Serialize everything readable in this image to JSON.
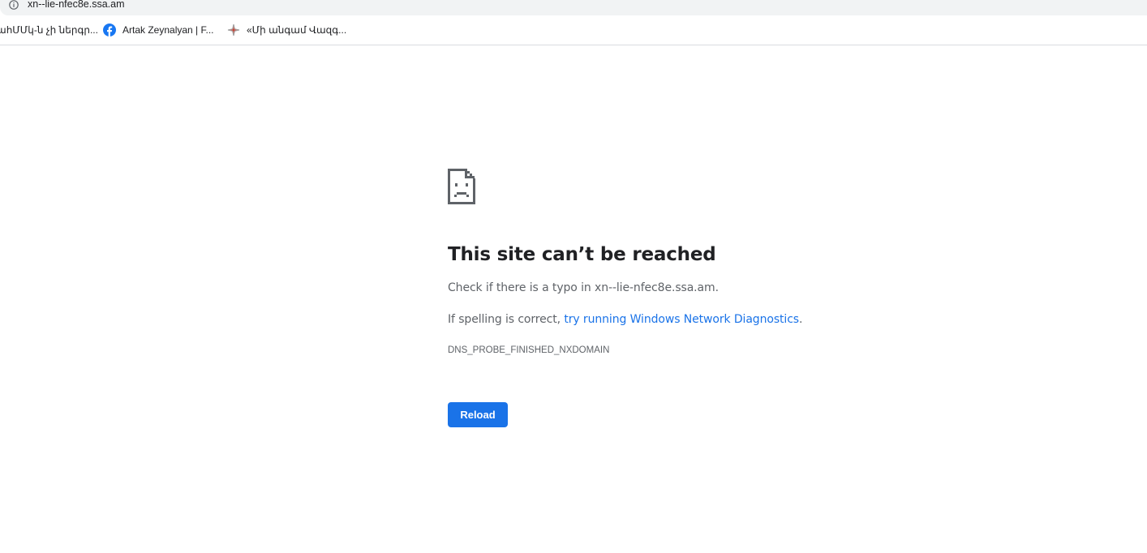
{
  "omnibox": {
    "url": "xn--lie-nfec8e.ssa.am",
    "icon": "info-icon"
  },
  "bookmarks": [
    {
      "label": "ահՄՄկ-ն չի ներգր...",
      "icon": "none"
    },
    {
      "label": "Artak Zeynalyan | F...",
      "icon": "facebook-icon"
    },
    {
      "label": "«Մի անգամ Վազգ...",
      "icon": "star-bookmark-icon"
    }
  ],
  "error": {
    "icon": "sad-document-icon",
    "title": "This site can’t be reached",
    "check_prefix": "Check if there is a typo in ",
    "check_domain": "xn--lie-nfec8e.ssa.am",
    "check_suffix": ".",
    "spelling_prefix": "If spelling is correct, ",
    "spelling_link": "try running Windows Network Diagnostics",
    "spelling_suffix": ".",
    "error_code": "DNS_PROBE_FINISHED_NXDOMAIN",
    "reload_label": "Reload"
  },
  "colors": {
    "accent": "#1a73e8",
    "text": "#202124",
    "secondary": "#5f6368",
    "facebook": "#1877f2"
  }
}
